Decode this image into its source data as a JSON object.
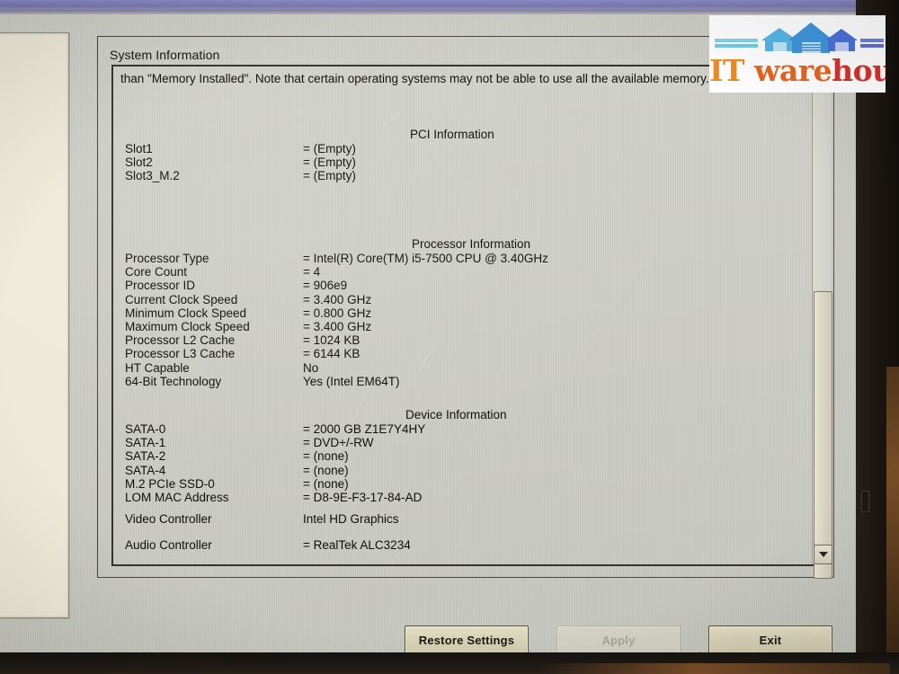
{
  "window": {
    "group_title": "System Information"
  },
  "intro": {
    "text": "than \"Memory Installed\". Note that certain operating systems may not be able to use all the available memory."
  },
  "sections": [
    {
      "title": "PCI Information",
      "rows": [
        {
          "key": "Slot1",
          "value": "= (Empty)"
        },
        {
          "key": "Slot2",
          "value": "= (Empty)"
        },
        {
          "key": "Slot3_M.2",
          "value": "= (Empty)"
        }
      ]
    },
    {
      "title": "Processor Information",
      "rows": [
        {
          "key": "Processor Type",
          "value": "= Intel(R) Core(TM) i5-7500 CPU @ 3.40GHz"
        },
        {
          "key": "Core Count",
          "value": "= 4"
        },
        {
          "key": "Processor ID",
          "value": "= 906e9"
        },
        {
          "key": "Current Clock Speed",
          "value": "= 3.400 GHz"
        },
        {
          "key": "Minimum Clock Speed",
          "value": "= 0.800 GHz"
        },
        {
          "key": "Maximum Clock Speed",
          "value": "= 3.400 GHz"
        },
        {
          "key": "Processor L2 Cache",
          "value": "= 1024 KB"
        },
        {
          "key": "Processor L3 Cache",
          "value": "= 6144 KB"
        },
        {
          "key": "HT Capable",
          "value": "No"
        },
        {
          "key": "64-Bit Technology",
          "value": "Yes (Intel EM64T)"
        }
      ]
    },
    {
      "title": "Device Information",
      "rows": [
        {
          "key": "SATA-0",
          "value": "= 2000 GB Z1E7Y4HY"
        },
        {
          "key": "SATA-1",
          "value": "= DVD+/-RW"
        },
        {
          "key": "SATA-2",
          "value": "= (none)"
        },
        {
          "key": "SATA-4",
          "value": "= (none)"
        },
        {
          "key": "M.2 PCIe SSD-0",
          "value": "= (none)"
        },
        {
          "key": "LOM MAC Address",
          "value": "= D8-9E-F3-17-84-AD"
        }
      ]
    }
  ],
  "controllers": [
    {
      "key": "Video Controller",
      "value": "Intel HD Graphics"
    },
    {
      "key": "Audio Controller",
      "value": "= RealTek ALC3234"
    }
  ],
  "footer": {
    "restore_label": "Restore Settings",
    "apply_label": "Apply",
    "exit_label": "Exit"
  },
  "scrollbar": {
    "down_arrow": "▼"
  },
  "logo": {
    "part1": "IT",
    "part2": "ware",
    "part3": "house",
    "full_text": "IT warehouse",
    "colors": {
      "orange": "#ef8b23",
      "red": "#d8312b",
      "house_light": "#4aa8e0",
      "house_mid": "#3f8fd8",
      "house_dark": "#4a5fc8"
    }
  },
  "theme": {
    "screen_bg": "#cdcec5",
    "text": "#100f0a",
    "button_face": "#d9d3b7",
    "nav_panel": "#efe9d8"
  }
}
